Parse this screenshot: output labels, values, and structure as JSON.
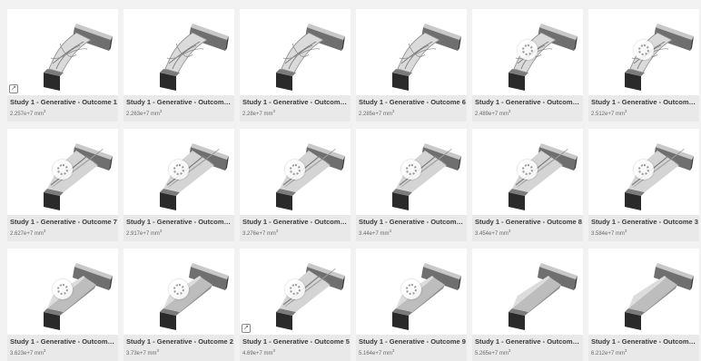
{
  "outcomes": [
    {
      "name": "Study 1 - Generative - Outcome 1",
      "volume": "2.257e+7",
      "unit": "mm",
      "loading": false,
      "export_icon": true,
      "style": "lattice"
    },
    {
      "name": "Study 1 - Generative - Outcome ...",
      "volume": "2.263e+7",
      "unit": "mm",
      "loading": false,
      "export_icon": false,
      "style": "lattice"
    },
    {
      "name": "Study 1 - Generative - Outcome ...",
      "volume": "2.28e+7",
      "unit": "mm",
      "loading": false,
      "export_icon": false,
      "style": "lattice"
    },
    {
      "name": "Study 1 - Generative - Outcome 6",
      "volume": "2.285e+7",
      "unit": "mm",
      "loading": false,
      "export_icon": false,
      "style": "lattice"
    },
    {
      "name": "Study 1 - Generative - Outcome ...",
      "volume": "2.489e+7",
      "unit": "mm",
      "loading": true,
      "export_icon": false,
      "style": "lattice"
    },
    {
      "name": "Study 1 - Generative - Outcome ...",
      "volume": "2.512e+7",
      "unit": "mm",
      "loading": true,
      "export_icon": false,
      "style": "lattice"
    },
    {
      "name": "Study 1 - Generative - Outcome 7",
      "volume": "2.627e+7",
      "unit": "mm",
      "loading": true,
      "export_icon": false,
      "style": "mesh"
    },
    {
      "name": "Study 1 - Generative - Outcome ...",
      "volume": "2.917e+7",
      "unit": "mm",
      "loading": true,
      "export_icon": false,
      "style": "mesh"
    },
    {
      "name": "Study 1 - Generative - Outcome ...",
      "volume": "3.276e+7",
      "unit": "mm",
      "loading": true,
      "export_icon": false,
      "style": "mesh"
    },
    {
      "name": "Study 1 - Generative - Outcome ...",
      "volume": "3.44e+7",
      "unit": "mm",
      "loading": true,
      "export_icon": false,
      "style": "mesh"
    },
    {
      "name": "Study 1 - Generative - Outcome 8",
      "volume": "3.454e+7",
      "unit": "mm",
      "loading": true,
      "export_icon": false,
      "style": "mesh"
    },
    {
      "name": "Study 1 - Generative - Outcome 3",
      "volume": "3.584e+7",
      "unit": "mm",
      "loading": true,
      "export_icon": false,
      "style": "mesh"
    },
    {
      "name": "Study 1 - Generative - Outcome ...",
      "volume": "3.623e+7",
      "unit": "mm",
      "loading": true,
      "export_icon": false,
      "style": "solid"
    },
    {
      "name": "Study 1 - Generative - Outcome 2",
      "volume": "3.73e+7",
      "unit": "mm",
      "loading": true,
      "export_icon": false,
      "style": "solid"
    },
    {
      "name": "Study 1 - Generative - Outcome 5",
      "volume": "4.69e+7",
      "unit": "mm",
      "loading": true,
      "export_icon": true,
      "style": "mesh"
    },
    {
      "name": "Study 1 - Generative - Outcome 9",
      "volume": "5.164e+7",
      "unit": "mm",
      "loading": true,
      "export_icon": false,
      "style": "solid"
    },
    {
      "name": "Study 1 - Generative - Outcome ...",
      "volume": "5.265e+7",
      "unit": "mm",
      "loading": false,
      "export_icon": false,
      "style": "solid"
    },
    {
      "name": "Study 1 - Generative - Outcome ...",
      "volume": "6.212e+7",
      "unit": "mm",
      "loading": false,
      "export_icon": false,
      "style": "solid"
    }
  ],
  "unit_power": "3",
  "colors": {
    "page_bg": "#f2f2f2",
    "card_bg": "#e9e9e9",
    "part": "#9a9a9a",
    "part_dark": "#2a2a2a"
  }
}
